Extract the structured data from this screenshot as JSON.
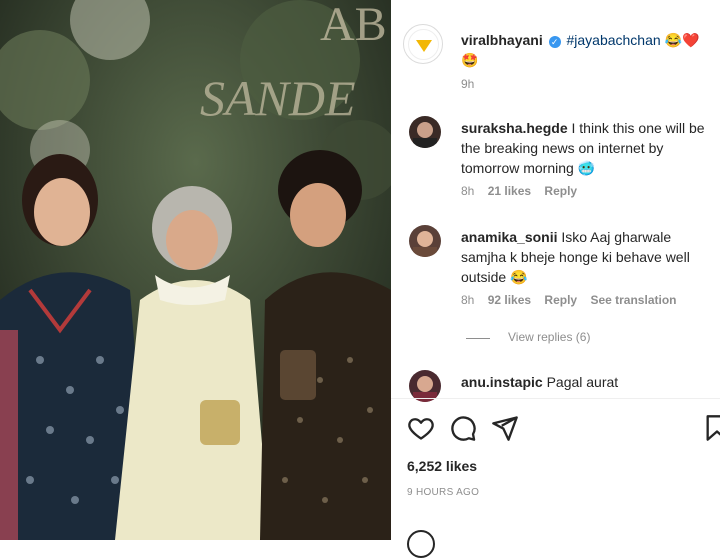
{
  "post": {
    "author": "viralbhayani",
    "caption_tag": "#jayabachchan",
    "caption_emoji": "😂❤️",
    "caption_emoji2": "🤩",
    "age": "9h"
  },
  "comments": [
    {
      "user": "suraksha.hegde",
      "text": "I think this one will be the breaking news on internet by tomorrow morning 🥶",
      "age": "8h",
      "likes": "21 likes",
      "reply": "Reply",
      "translate": ""
    },
    {
      "user": "anamika_sonii",
      "text": "Isko Aaj gharwale samjha k bheje honge ki behave well outside 😂",
      "age": "8h",
      "likes": "92 likes",
      "reply": "Reply",
      "translate": "See translation",
      "view_replies": "View replies (6)"
    },
    {
      "user": "anu.instapic",
      "text": "Pagal aurat"
    }
  ],
  "footer": {
    "likes": "6,252 likes",
    "time": "9 HOURS AGO"
  },
  "photo_text": "ABU SANDEEP"
}
